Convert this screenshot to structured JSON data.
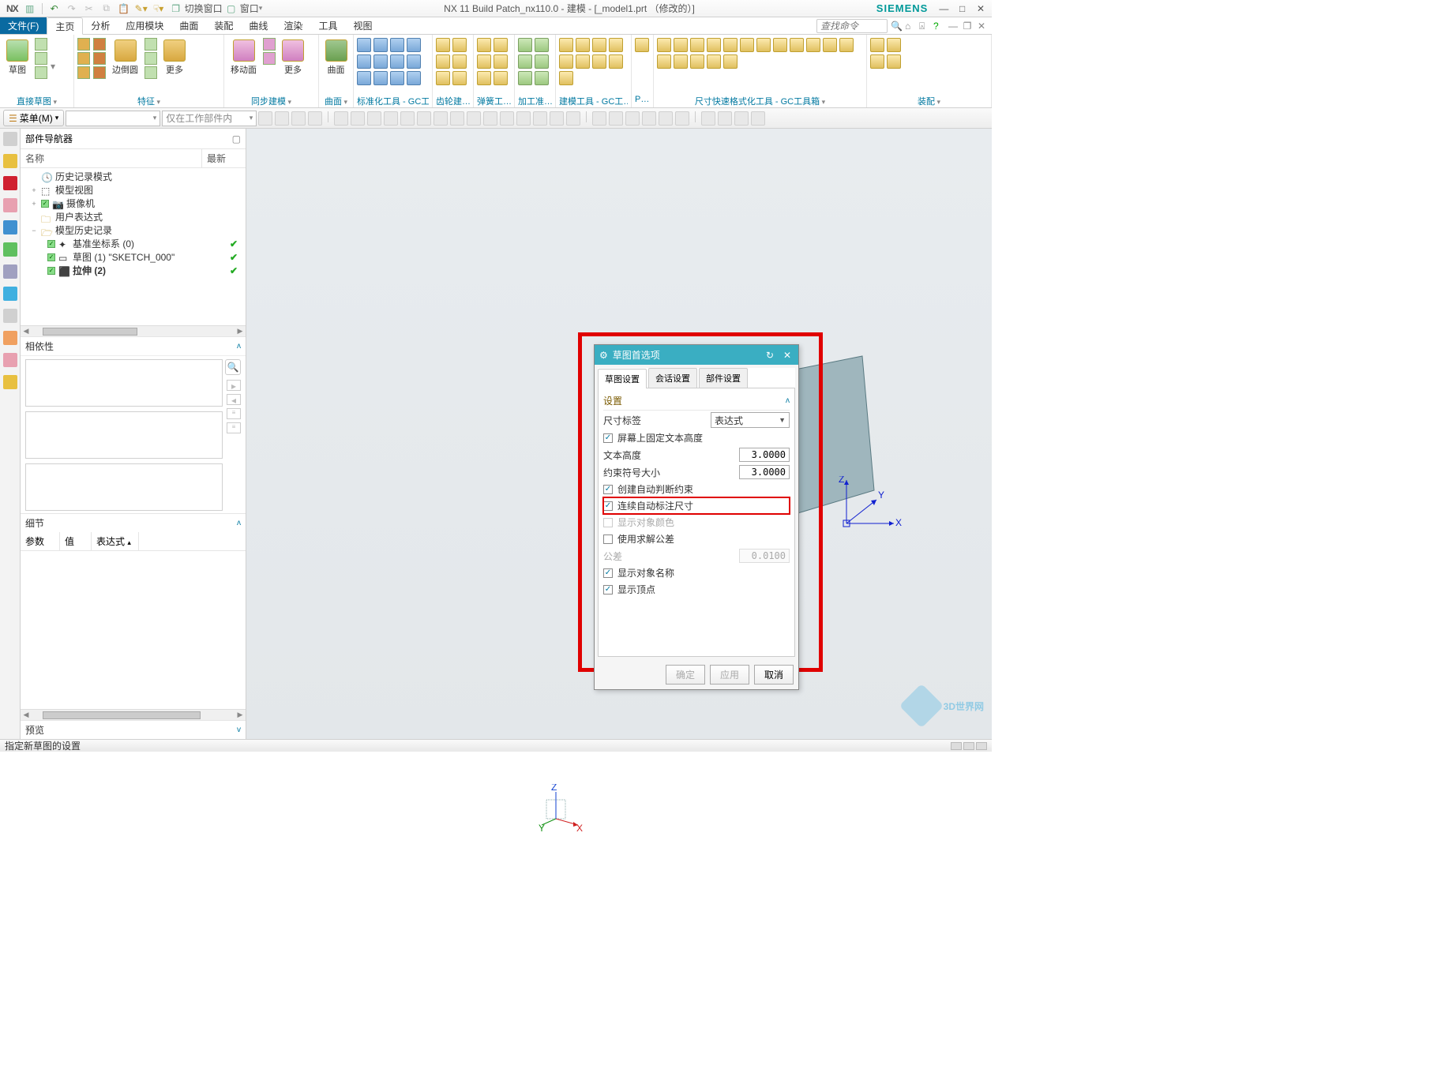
{
  "app": {
    "logo": "NX",
    "title": "NX 11  Build Patch_nx110.0 - 建模 - [_model1.prt （修改的）]",
    "brand": "SIEMENS"
  },
  "quick": {
    "switch_window": "切换窗口",
    "window_menu": "窗口"
  },
  "menu": {
    "file": "文件(F)",
    "tabs": [
      "主页",
      "分析",
      "应用模块",
      "曲面",
      "装配",
      "曲线",
      "渲染",
      "工具",
      "视图"
    ],
    "active": "主页"
  },
  "search": {
    "placeholder": "查找命令"
  },
  "ribbon": {
    "groups": {
      "g1": {
        "label": "直接草图",
        "btn1": "草图"
      },
      "g2": {
        "label": "特征",
        "btn1": "边倒圆",
        "btn2": "更多"
      },
      "g3": {
        "label": "同步建模",
        "btn1": "移动面",
        "btn2": "更多"
      },
      "g4": {
        "label": "曲面",
        "btn1": "曲面"
      },
      "g5": {
        "label": "标准化工具 - GC工…"
      },
      "g6": {
        "label": "齿轮建…"
      },
      "g7": {
        "label": "弹簧工…"
      },
      "g8": {
        "label": "加工准…"
      },
      "g9": {
        "label": "建模工具 - GC工…"
      },
      "g10": {
        "label": "P…"
      },
      "g11": {
        "label": "尺寸快速格式化工具 - GC工具箱"
      },
      "g12": {
        "label": "装配"
      }
    }
  },
  "toolbar2": {
    "menu_btn": "菜单(M)",
    "combo_placeholder": "仅在工作部件内"
  },
  "navigator": {
    "title": "部件导航器",
    "cols": {
      "name": "名称",
      "latest": "最新"
    },
    "rows": {
      "history_mode": "历史记录模式",
      "model_view": "模型视图",
      "camera": "摄像机",
      "user_expr": "用户表达式",
      "model_history": "模型历史记录",
      "datum": "基准坐标系 (0)",
      "sketch": "草图 (1) \"SKETCH_000\"",
      "extrude": "拉伸 (2)"
    }
  },
  "panels": {
    "dependency": "相依性",
    "details": "细节",
    "preview": "预览"
  },
  "details_cols": {
    "param": "参数",
    "value": "值",
    "expr": "表达式"
  },
  "dialog": {
    "title": "草图首选项",
    "tabs": {
      "sketch": "草图设置",
      "session": "会话设置",
      "part": "部件设置"
    },
    "section": "设置",
    "labels": {
      "dim_label": "尺寸标签",
      "expr_sel": "表达式",
      "fixed_text_height": "屏幕上固定文本高度",
      "text_height": "文本高度",
      "text_height_val": "3.0000",
      "constraint_size": "约束符号大小",
      "constraint_size_val": "3.0000",
      "create_infer": "创建自动判断约束",
      "continuous_dim": "连续自动标注尺寸",
      "show_color": "显示对象颜色",
      "use_tol": "使用求解公差",
      "tolerance": "公差",
      "tolerance_val": "0.0100",
      "show_name": "显示对象名称",
      "show_vertex": "显示顶点"
    },
    "buttons": {
      "ok": "确定",
      "apply": "应用",
      "cancel": "取消"
    }
  },
  "status": {
    "msg": "指定新草图的设置"
  },
  "watermark": {
    "text": "3D世界网"
  }
}
